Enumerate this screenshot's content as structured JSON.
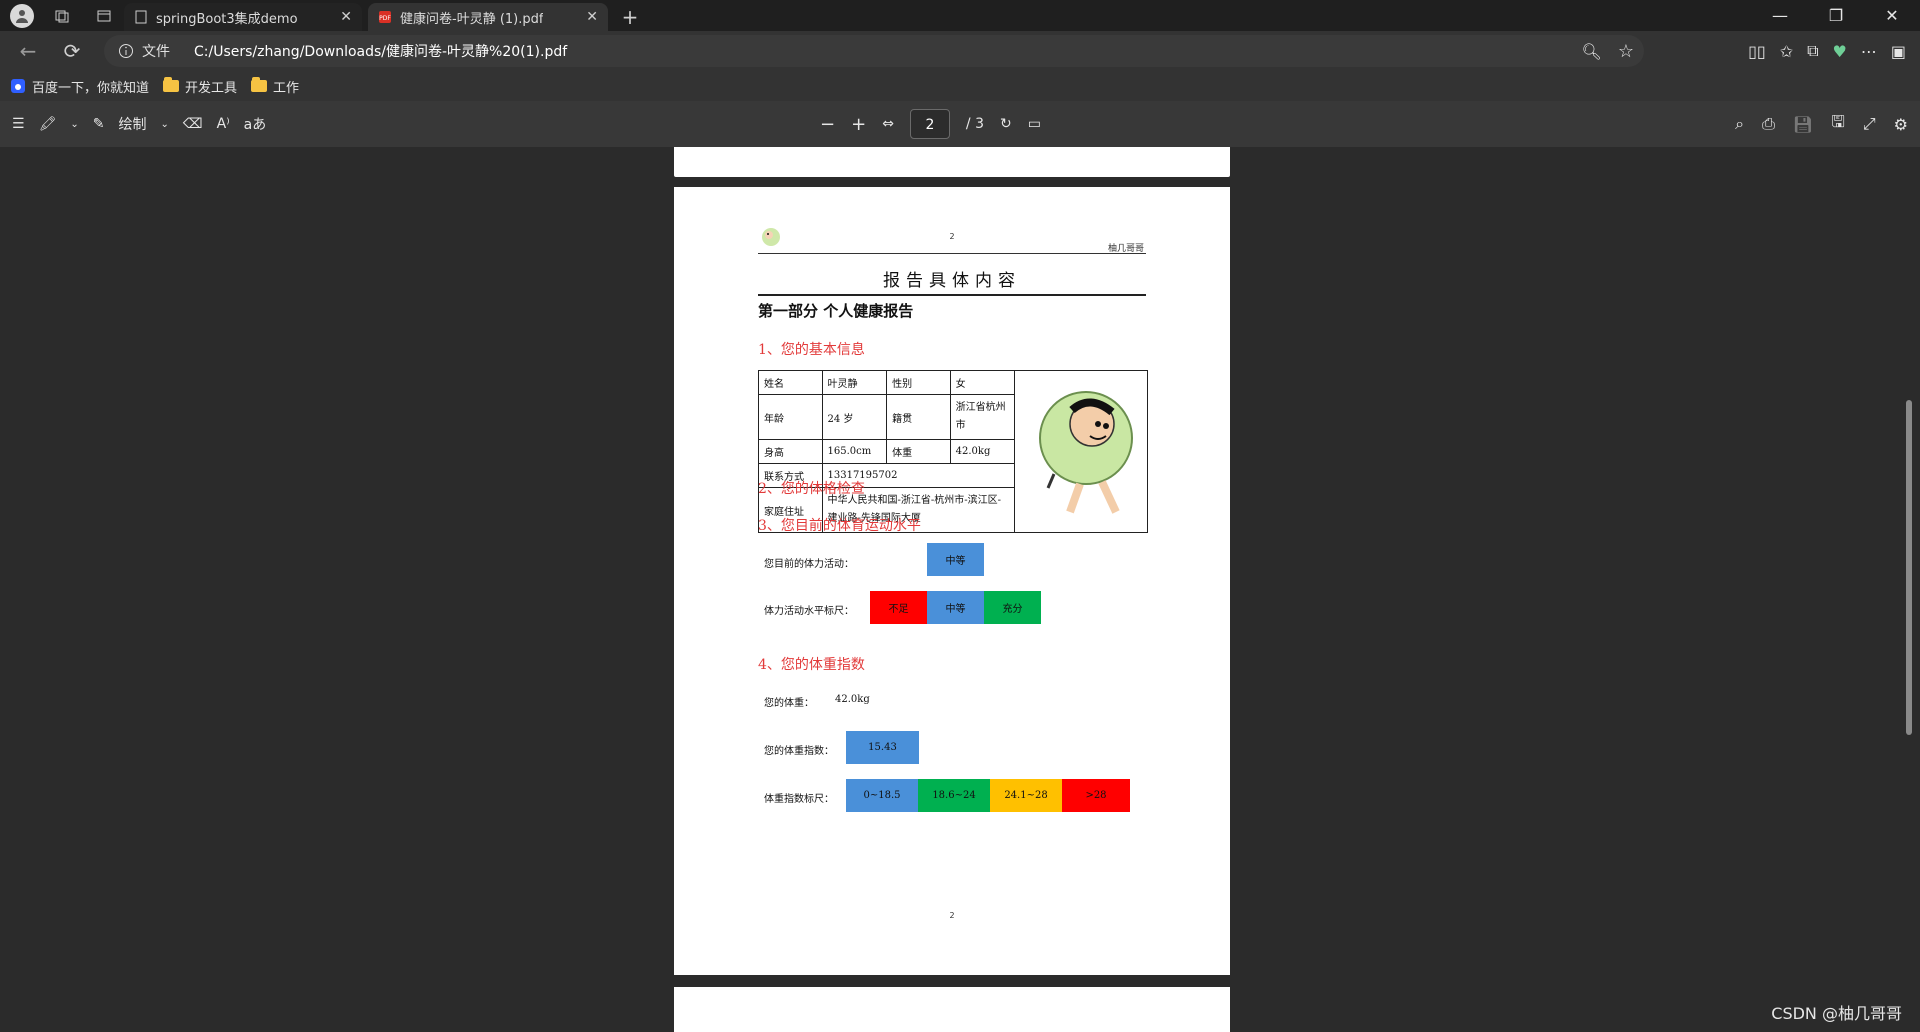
{
  "tabs": [
    {
      "title": "springBoot3集成demo",
      "active": false
    },
    {
      "title": "健康问卷-叶灵静 (1).pdf",
      "active": true
    }
  ],
  "address": {
    "site_label": "文件",
    "url": "C:/Users/zhang/Downloads/健康问卷-叶灵静%20(1).pdf"
  },
  "bookmarks": [
    {
      "label": "百度一下，你就知道",
      "type": "site"
    },
    {
      "label": "开发工具",
      "type": "folder"
    },
    {
      "label": "工作",
      "type": "folder"
    }
  ],
  "pdf_toolbar": {
    "draw_label": "绘制",
    "text_label": "aあ",
    "page_current": "2",
    "page_total": "/ 3"
  },
  "doc": {
    "header_page_no": "2",
    "header_right": "柚几哥哥",
    "title": "报告具体内容",
    "part_title": "第一部分 个人健康报告",
    "sections": {
      "s1": "1、您的基本信息",
      "s2": "2、您的体格检查",
      "s3": "3、您目前的体育运动水平",
      "s4": "4、您的体重指数"
    },
    "info": {
      "name_label": "姓名",
      "name_value": "叶灵静",
      "gender_label": "性别",
      "gender_value": "女",
      "age_label": "年龄",
      "age_value": "24 岁",
      "origin_label": "籍贯",
      "origin_value": "浙江省杭州市",
      "height_label": "身高",
      "height_value": "165.0cm",
      "weight_label": "体重",
      "weight_value": "42.0kg",
      "phone_label": "联系方式",
      "phone_value": "13317195702",
      "address_label": "家庭住址",
      "address_value": "中华人民共和国-浙江省-杭州市-滨江区-建业路-先锋国际大厦"
    },
    "activity": {
      "current_label": "您目前的体力活动：",
      "current_value": "中等",
      "scale_label": "体力活动水平标尺：",
      "scale": [
        "不足",
        "中等",
        "充分"
      ]
    },
    "bmi": {
      "weight_label": "您的体重：",
      "weight_value": "42.0kg",
      "index_label": "您的体重指数：",
      "index_value": "15.43",
      "scale_label": "体重指数标尺：",
      "scale": [
        "0~18.5",
        "18.6~24",
        "24.1~28",
        ">28"
      ]
    },
    "footer_page_no": "2"
  },
  "watermark": "CSDN @柚几哥哥",
  "colors": {
    "section_red": "#e23a3a",
    "blue": "#4a90d9",
    "red": "#ff0000",
    "green": "#00b050",
    "yellow": "#ffc000"
  }
}
